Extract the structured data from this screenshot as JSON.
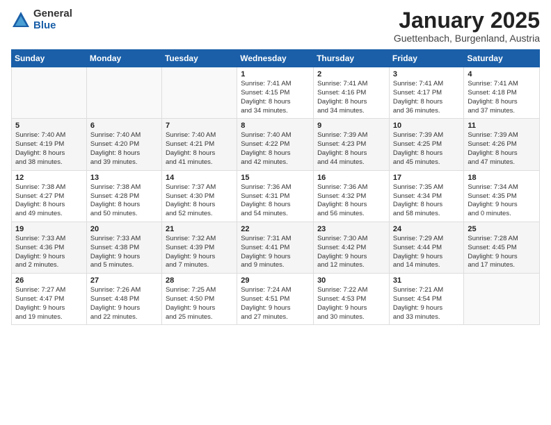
{
  "logo": {
    "general": "General",
    "blue": "Blue"
  },
  "title": "January 2025",
  "subtitle": "Guettenbach, Burgenland, Austria",
  "weekdays": [
    "Sunday",
    "Monday",
    "Tuesday",
    "Wednesday",
    "Thursday",
    "Friday",
    "Saturday"
  ],
  "weeks": [
    [
      {
        "num": "",
        "info": ""
      },
      {
        "num": "",
        "info": ""
      },
      {
        "num": "",
        "info": ""
      },
      {
        "num": "1",
        "info": "Sunrise: 7:41 AM\nSunset: 4:15 PM\nDaylight: 8 hours\nand 34 minutes."
      },
      {
        "num": "2",
        "info": "Sunrise: 7:41 AM\nSunset: 4:16 PM\nDaylight: 8 hours\nand 34 minutes."
      },
      {
        "num": "3",
        "info": "Sunrise: 7:41 AM\nSunset: 4:17 PM\nDaylight: 8 hours\nand 36 minutes."
      },
      {
        "num": "4",
        "info": "Sunrise: 7:41 AM\nSunset: 4:18 PM\nDaylight: 8 hours\nand 37 minutes."
      }
    ],
    [
      {
        "num": "5",
        "info": "Sunrise: 7:40 AM\nSunset: 4:19 PM\nDaylight: 8 hours\nand 38 minutes."
      },
      {
        "num": "6",
        "info": "Sunrise: 7:40 AM\nSunset: 4:20 PM\nDaylight: 8 hours\nand 39 minutes."
      },
      {
        "num": "7",
        "info": "Sunrise: 7:40 AM\nSunset: 4:21 PM\nDaylight: 8 hours\nand 41 minutes."
      },
      {
        "num": "8",
        "info": "Sunrise: 7:40 AM\nSunset: 4:22 PM\nDaylight: 8 hours\nand 42 minutes."
      },
      {
        "num": "9",
        "info": "Sunrise: 7:39 AM\nSunset: 4:23 PM\nDaylight: 8 hours\nand 44 minutes."
      },
      {
        "num": "10",
        "info": "Sunrise: 7:39 AM\nSunset: 4:25 PM\nDaylight: 8 hours\nand 45 minutes."
      },
      {
        "num": "11",
        "info": "Sunrise: 7:39 AM\nSunset: 4:26 PM\nDaylight: 8 hours\nand 47 minutes."
      }
    ],
    [
      {
        "num": "12",
        "info": "Sunrise: 7:38 AM\nSunset: 4:27 PM\nDaylight: 8 hours\nand 49 minutes."
      },
      {
        "num": "13",
        "info": "Sunrise: 7:38 AM\nSunset: 4:28 PM\nDaylight: 8 hours\nand 50 minutes."
      },
      {
        "num": "14",
        "info": "Sunrise: 7:37 AM\nSunset: 4:30 PM\nDaylight: 8 hours\nand 52 minutes."
      },
      {
        "num": "15",
        "info": "Sunrise: 7:36 AM\nSunset: 4:31 PM\nDaylight: 8 hours\nand 54 minutes."
      },
      {
        "num": "16",
        "info": "Sunrise: 7:36 AM\nSunset: 4:32 PM\nDaylight: 8 hours\nand 56 minutes."
      },
      {
        "num": "17",
        "info": "Sunrise: 7:35 AM\nSunset: 4:34 PM\nDaylight: 8 hours\nand 58 minutes."
      },
      {
        "num": "18",
        "info": "Sunrise: 7:34 AM\nSunset: 4:35 PM\nDaylight: 9 hours\nand 0 minutes."
      }
    ],
    [
      {
        "num": "19",
        "info": "Sunrise: 7:33 AM\nSunset: 4:36 PM\nDaylight: 9 hours\nand 2 minutes."
      },
      {
        "num": "20",
        "info": "Sunrise: 7:33 AM\nSunset: 4:38 PM\nDaylight: 9 hours\nand 5 minutes."
      },
      {
        "num": "21",
        "info": "Sunrise: 7:32 AM\nSunset: 4:39 PM\nDaylight: 9 hours\nand 7 minutes."
      },
      {
        "num": "22",
        "info": "Sunrise: 7:31 AM\nSunset: 4:41 PM\nDaylight: 9 hours\nand 9 minutes."
      },
      {
        "num": "23",
        "info": "Sunrise: 7:30 AM\nSunset: 4:42 PM\nDaylight: 9 hours\nand 12 minutes."
      },
      {
        "num": "24",
        "info": "Sunrise: 7:29 AM\nSunset: 4:44 PM\nDaylight: 9 hours\nand 14 minutes."
      },
      {
        "num": "25",
        "info": "Sunrise: 7:28 AM\nSunset: 4:45 PM\nDaylight: 9 hours\nand 17 minutes."
      }
    ],
    [
      {
        "num": "26",
        "info": "Sunrise: 7:27 AM\nSunset: 4:47 PM\nDaylight: 9 hours\nand 19 minutes."
      },
      {
        "num": "27",
        "info": "Sunrise: 7:26 AM\nSunset: 4:48 PM\nDaylight: 9 hours\nand 22 minutes."
      },
      {
        "num": "28",
        "info": "Sunrise: 7:25 AM\nSunset: 4:50 PM\nDaylight: 9 hours\nand 25 minutes."
      },
      {
        "num": "29",
        "info": "Sunrise: 7:24 AM\nSunset: 4:51 PM\nDaylight: 9 hours\nand 27 minutes."
      },
      {
        "num": "30",
        "info": "Sunrise: 7:22 AM\nSunset: 4:53 PM\nDaylight: 9 hours\nand 30 minutes."
      },
      {
        "num": "31",
        "info": "Sunrise: 7:21 AM\nSunset: 4:54 PM\nDaylight: 9 hours\nand 33 minutes."
      },
      {
        "num": "",
        "info": ""
      }
    ]
  ]
}
